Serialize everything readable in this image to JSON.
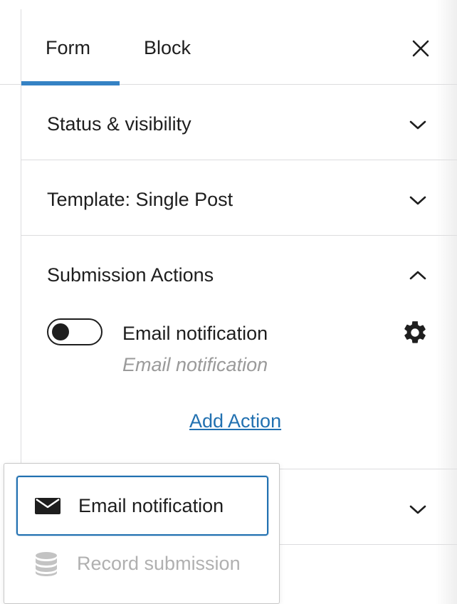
{
  "tabs": {
    "form_label": "Form",
    "block_label": "Block",
    "active": "Form"
  },
  "panels": [
    {
      "title": "Status & visibility",
      "expanded": false
    },
    {
      "title": "Template: Single Post",
      "expanded": false
    },
    {
      "title": "Submission Actions",
      "expanded": true
    }
  ],
  "submission_actions": {
    "items": [
      {
        "label": "Email notification",
        "description": "Email notification",
        "enabled": false
      }
    ],
    "add_action_label": "Add Action"
  },
  "add_action_menu": {
    "items": [
      {
        "label": "Email notification",
        "icon": "envelope-icon",
        "focused": true
      },
      {
        "label": "Record submission",
        "icon": "database-icon",
        "disabled": true
      }
    ]
  },
  "colors": {
    "accent": "#3582c4",
    "link": "#2271b1",
    "text": "#1e1e1e",
    "muted": "#9a9a9a",
    "border": "#dcdcde"
  }
}
